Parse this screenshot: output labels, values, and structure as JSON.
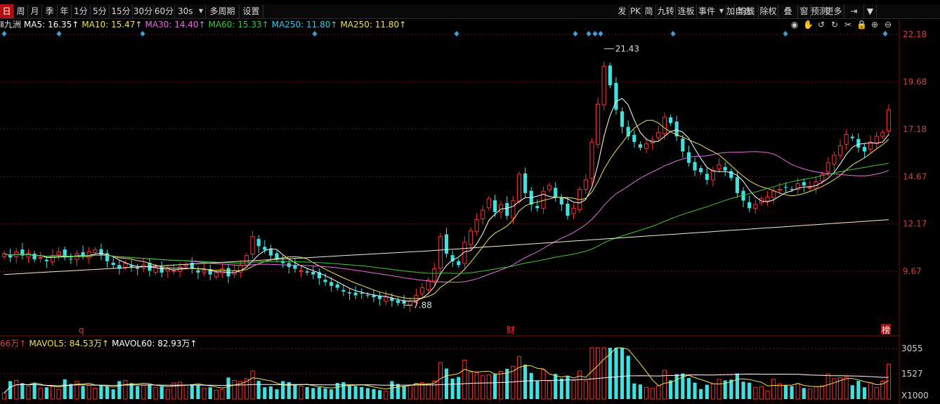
{
  "toolbar": {
    "left": [
      {
        "id": "day",
        "label": "日",
        "active": true
      },
      {
        "id": "week",
        "label": "周"
      },
      {
        "id": "month",
        "label": "月"
      },
      {
        "id": "season",
        "label": "季"
      },
      {
        "id": "year",
        "label": "年"
      },
      {
        "id": "1m",
        "label": "1分"
      },
      {
        "id": "5m",
        "label": "5分"
      },
      {
        "id": "15m",
        "label": "15分"
      },
      {
        "id": "30m",
        "label": "30分"
      },
      {
        "id": "60m",
        "label": "60分"
      },
      {
        "id": "30s",
        "label": "30s",
        "dropdown": true
      },
      {
        "id": "multi",
        "label": "多周期"
      },
      {
        "id": "settings",
        "label": "设置"
      }
    ],
    "right": [
      {
        "id": "fa",
        "label": "发"
      },
      {
        "id": "pk",
        "label": "PK"
      },
      {
        "id": "jian",
        "label": "简"
      },
      {
        "id": "jiuzhuan",
        "label": "九转"
      },
      {
        "id": "lianban",
        "label": "连板"
      },
      {
        "id": "shijian",
        "label": "事件",
        "dropdown": true
      },
      {
        "id": "jiazixuan",
        "label": "加自选"
      },
      {
        "id": "junxian",
        "label": "均线"
      },
      {
        "id": "chuquan",
        "label": "除权"
      },
      {
        "id": "die",
        "label": "叠"
      },
      {
        "id": "chuang",
        "label": "窗"
      },
      {
        "id": "yuce",
        "label": "预测"
      },
      {
        "id": "more",
        "label": "更多"
      },
      {
        "id": "exit",
        "label": "⇥"
      },
      {
        "id": "menu",
        "label": "▼"
      }
    ]
  },
  "legend": {
    "stock": "Ⅱ九洲",
    "items": [
      {
        "text": "MA5: 16.35↑",
        "color": "#ffffff"
      },
      {
        "text": "MA10: 15.47↑",
        "color": "#f0e05a"
      },
      {
        "text": "MA30: 14.40↑",
        "color": "#e070e0"
      },
      {
        "text": "MA60: 15.33↑",
        "color": "#3ec83e"
      },
      {
        "text": "MA250: 11.80↑",
        "color": "#40c8e8"
      },
      {
        "text": "MA250: 11.80↑",
        "color": "#f0e05a"
      }
    ]
  },
  "tools": [
    "eye-icon",
    "hand-icon",
    "undo-icon",
    "redo-icon",
    "scissors-icon",
    "lock-icon",
    "plus-circle-icon",
    "minus-circle-icon"
  ],
  "tool_glyphs": [
    "◉",
    "✋",
    "↺",
    "↻",
    "✂",
    "🔒",
    "⊕",
    "⊖"
  ],
  "price_axis": [
    "22.18",
    "19.68",
    "17.18",
    "14.67",
    "12.17",
    "9.67"
  ],
  "annotations": {
    "high": "21.43",
    "low": "7.88",
    "mark_q": "q",
    "mark_cai": "财",
    "mark_bang": "榜"
  },
  "volume": {
    "legend": [
      {
        "text": "66万↑",
        "color": "#e04040"
      },
      {
        "text": "MAVOL5: 84.53万↑",
        "color": "#f0e05a"
      },
      {
        "text": "MAVOL60: 82.93万↑",
        "color": "#ffffff"
      }
    ],
    "axis": [
      "3055",
      "1527",
      "X1000"
    ]
  },
  "chart_data": {
    "type": "candlestick",
    "ylim": [
      7.0,
      23.0
    ],
    "closes": [
      10.6,
      10.4,
      10.7,
      10.5,
      10.6,
      10.3,
      10.4,
      10.2,
      10.5,
      10.7,
      10.4,
      10.3,
      10.6,
      10.5,
      10.7,
      10.8,
      10.5,
      10.2,
      10.0,
      9.8,
      10.1,
      9.9,
      9.8,
      10.0,
      9.7,
      9.9,
      9.6,
      9.8,
      9.7,
      9.9,
      10.0,
      9.8,
      9.6,
      9.7,
      9.5,
      9.6,
      9.8,
      9.4,
      9.7,
      10.0,
      10.5,
      11.5,
      11.0,
      10.8,
      10.5,
      10.3,
      10.1,
      9.9,
      9.8,
      9.7,
      9.6,
      9.5,
      9.3,
      9.1,
      8.9,
      8.8,
      8.6,
      8.5,
      8.4,
      8.5,
      8.4,
      8.3,
      8.2,
      8.3,
      8.1,
      8.0,
      7.95,
      8.1,
      8.4,
      8.8,
      9.2,
      9.8,
      11.5,
      10.6,
      10.2,
      10.0,
      11.2,
      11.8,
      12.4,
      12.9,
      13.5,
      12.8,
      13.2,
      12.6,
      13.4,
      14.8,
      13.8,
      13.2,
      13.0,
      13.9,
      14.2,
      13.6,
      13.2,
      12.6,
      13.0,
      14.0,
      14.5,
      16.5,
      18.5,
      20.5,
      19.5,
      18.2,
      17.3,
      16.8,
      16.5,
      16.2,
      16.4,
      16.6,
      17.0,
      17.8,
      17.5,
      16.8,
      16.0,
      15.4,
      15.0,
      14.9,
      14.5,
      15.0,
      15.3,
      15.0,
      14.6,
      13.8,
      13.4,
      13.0,
      13.2,
      13.5,
      13.6,
      13.9,
      14.0,
      14.1,
      14.0,
      14.3,
      14.2,
      14.1,
      14.4,
      14.8,
      15.4,
      15.8,
      16.3,
      16.9,
      16.7,
      16.2,
      16.0,
      16.5,
      16.8,
      17.0,
      18.2
    ],
    "ma_labels": [
      "MA5",
      "MA10",
      "MA30",
      "MA60",
      "MA250"
    ]
  }
}
